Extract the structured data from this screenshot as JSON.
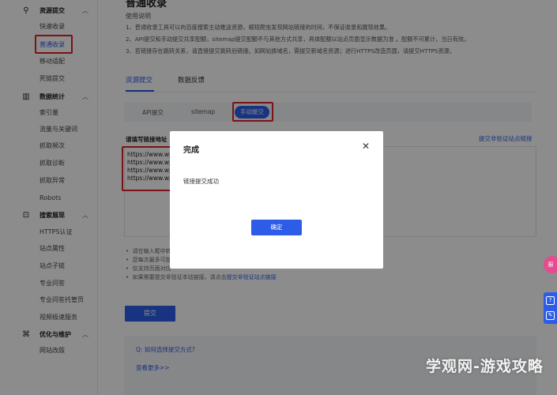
{
  "sidebar": {
    "sections": [
      {
        "title": "资源提交",
        "icon": "link-icon",
        "items": [
          "快速收录",
          "普通收录",
          "移动适配",
          "死链提交"
        ]
      },
      {
        "title": "数据统计",
        "icon": "bar-chart-icon",
        "items": [
          "索引量",
          "流量与关键词",
          "抓取频次",
          "抓取诊断",
          "抓取异常",
          "Robots"
        ]
      },
      {
        "title": "搜索展现",
        "icon": "search-display-icon",
        "items": [
          "HTTPS认证",
          "站点属性",
          "站点子链",
          "专业问答",
          "专业问答托管页",
          "视频极速服务"
        ]
      },
      {
        "title": "优化与维护",
        "icon": "grid-tools-icon",
        "items": [
          "网站改版"
        ]
      }
    ],
    "active_item": "普通收录"
  },
  "main": {
    "page_title": "普通收录",
    "usage_title": "使用说明",
    "usage_lines": [
      "1、普通收录工具可以向百度搜索主动推送资源，缩短爬虫发现网站链接的时间，不保证收录和展现效果。",
      "2、API提交和手动提交共享配额，sitemap提交配额不与其他方式共享，具体配额以站点页面显示数据为准 。配额不可累计，当日有效。",
      "3、若链接存在跳转关系，请直接提交跳转后链接。如网站换域名，需提交新域名资源；进行HTTPS改造页面，请提交HTTPS资源。"
    ],
    "tabs": [
      "资源提交",
      "数据反馈"
    ],
    "subtabs": [
      "API提交",
      "sitemap",
      "手动提交"
    ],
    "field_label": "请填写链接地址",
    "right_link": "提交非验证站点链接",
    "url_lines": [
      "https://www.wjh",
      "https://www.wjh",
      "https://www.wjh",
      "https://www.wjh"
    ],
    "bullets": [
      "请在输入框中转",
      "您每次最多可提",
      "仅支持页面对应",
      "如果需要提交非验证本站链接，请点击"
    ],
    "bullet_link": "提交非验证站点链接",
    "submit_label": "提交",
    "faq_question": "Q:  如何选择提交方式?",
    "faq_more": "查看更多>>"
  },
  "modal": {
    "title": "完成",
    "message": "链接提交成功",
    "ok_label": "确定"
  },
  "floating": {
    "pink_label": "报"
  },
  "watermark": "学观网-游戏攻略",
  "colors": {
    "primary": "#2d5de8",
    "highlight": "#e0222b",
    "overlay": "rgba(0,0,0,0.45)"
  }
}
